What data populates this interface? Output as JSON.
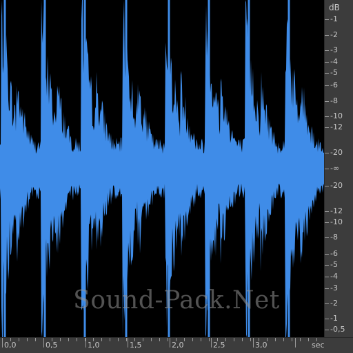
{
  "colors": {
    "waveform": "#3f8ce8",
    "background": "#000000",
    "ruler_background": "#3c3c3c",
    "ruler_text": "#c8c8c8"
  },
  "db_ruler": {
    "unit": "dB",
    "labels_top": [
      "-1",
      "-2",
      "-3",
      "-4",
      "-5",
      "-6",
      "-8",
      "-10",
      "-12",
      "-20"
    ],
    "center_label": "-∞",
    "labels_bottom": [
      "-20",
      "-12",
      "-10",
      "-8",
      "-6",
      "-5",
      "-4",
      "-3",
      "-2",
      "-1",
      "-0,5"
    ]
  },
  "time_ruler": {
    "unit": "sec",
    "labels": [
      "0,0",
      "0,5",
      "1,0",
      "1,5",
      "2,0",
      "2,5",
      "3,0"
    ]
  },
  "watermark": "Sound-Pack.Net"
}
